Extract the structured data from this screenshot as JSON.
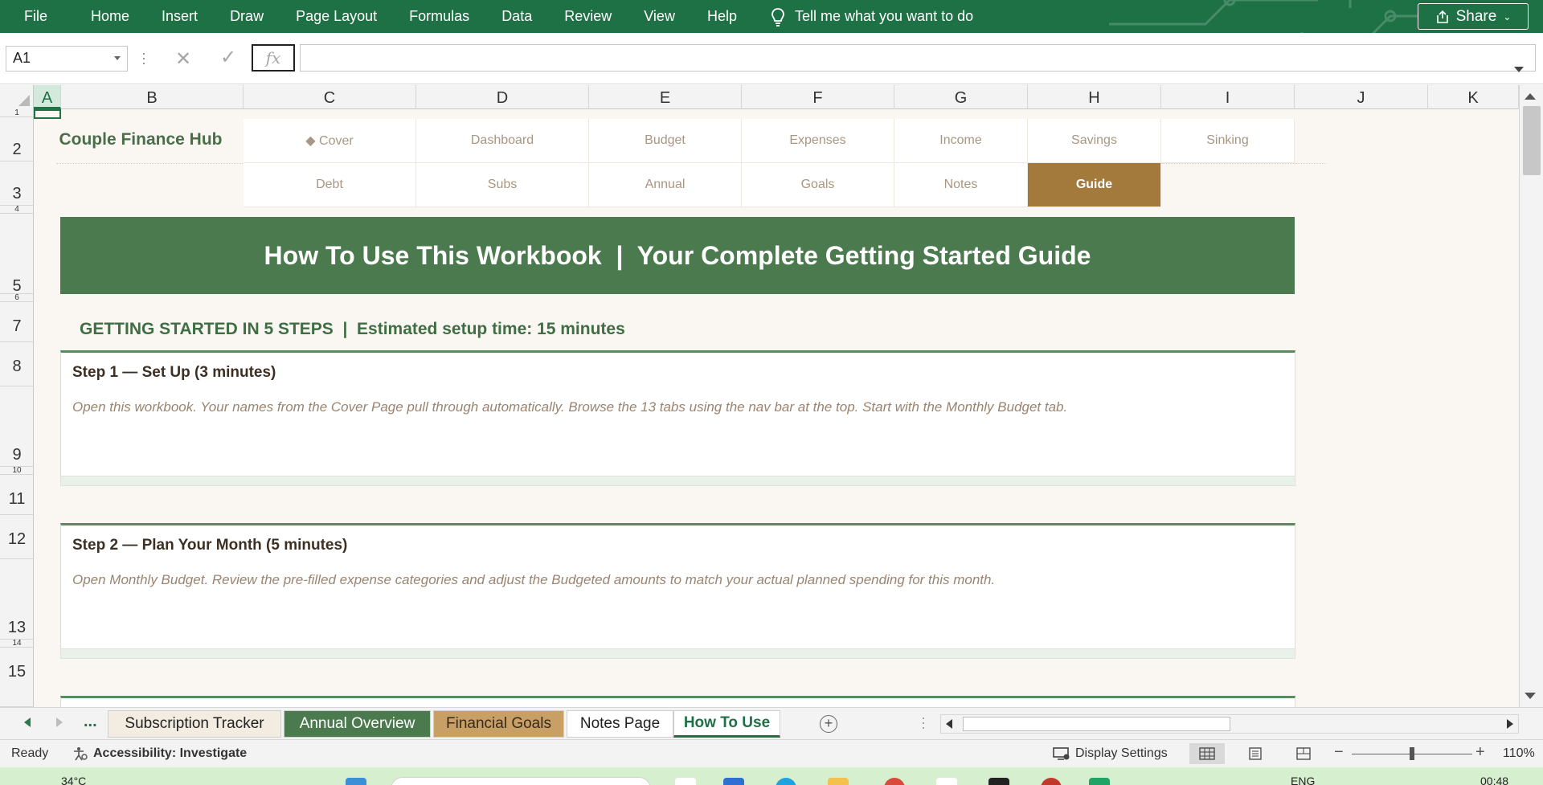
{
  "ribbon": {
    "tabs": [
      "File",
      "Home",
      "Insert",
      "Draw",
      "Page Layout",
      "Formulas",
      "Data",
      "Review",
      "View",
      "Help"
    ],
    "tell_me": "Tell me what you want to do",
    "share": "Share",
    "bg_color": "#1e7145"
  },
  "formula_bar": {
    "name_box": "A1",
    "formula": "",
    "fx_label": "fx"
  },
  "columns": [
    "A",
    "B",
    "C",
    "D",
    "E",
    "F",
    "G",
    "H",
    "I",
    "J",
    "K"
  ],
  "rows": [
    "1",
    "2",
    "3",
    "4",
    "5",
    "6",
    "7",
    "8",
    "9",
    "10",
    "11",
    "12",
    "13",
    "14",
    "15"
  ],
  "sheet": {
    "brand": "Couple Finance Hub",
    "nav_row1": [
      "◆ Cover",
      "Dashboard",
      "Budget",
      "Expenses",
      "Income",
      "Savings",
      "Sinking"
    ],
    "nav_row2": [
      "Debt",
      "Subs",
      "Annual",
      "Goals",
      "Notes",
      "Guide"
    ],
    "nav_active": "Guide",
    "banner_title": "How To Use This Workbook  |  Your Complete Getting Started Guide",
    "steps_heading": "GETTING STARTED IN 5 STEPS  |  Estimated setup time: 15 minutes",
    "steps": [
      {
        "title": "Step 1 — Set Up (3 minutes)",
        "body": "Open this workbook. Your names from the Cover Page pull through automatically. Browse the 13 tabs using the nav bar at the top. Start with the Monthly Budget tab."
      },
      {
        "title": "Step 2 — Plan Your Month (5 minutes)",
        "body": "Open Monthly Budget. Review the pre-filled expense categories and adjust the Budgeted amounts to match your actual planned spending for this month."
      }
    ],
    "accent_green": "#4b7a4e",
    "accent_tan": "#a47a3c"
  },
  "sheet_tabs": {
    "more": "...",
    "tabs": [
      "Subscription Tracker",
      "Annual Overview",
      "Financial Goals",
      "Notes Page",
      "How To Use"
    ],
    "active": "How To Use"
  },
  "status_bar": {
    "ready": "Ready",
    "accessibility": "Accessibility: Investigate",
    "display_settings": "Display Settings",
    "zoom": "110%"
  },
  "taskbar": {
    "weather": "34°C",
    "lang": "ENG",
    "time": "00:48"
  }
}
